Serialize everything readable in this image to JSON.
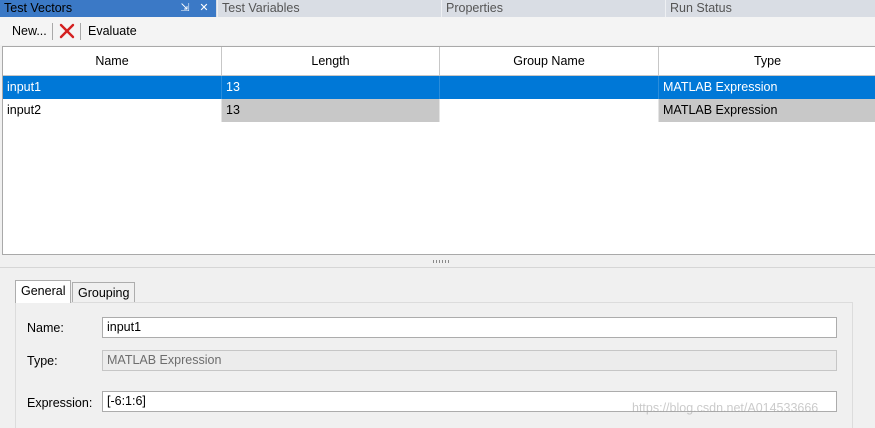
{
  "tabs": [
    {
      "label": "Test Vectors",
      "active": true
    },
    {
      "label": "Test Variables",
      "active": false
    },
    {
      "label": "Properties",
      "active": false
    },
    {
      "label": "Run Status",
      "active": false
    }
  ],
  "tab_controls": {
    "pin": "⇲",
    "close": "✕"
  },
  "toolbar": {
    "new_label": "New...",
    "delete_icon": "red-x-icon",
    "evaluate_label": "Evaluate"
  },
  "grid": {
    "columns": [
      "Name",
      "Length",
      "Group Name",
      "Type"
    ],
    "rows": [
      {
        "name": "input1",
        "length": "13",
        "group": "",
        "type": "MATLAB Expression",
        "selected": true
      },
      {
        "name": "input2",
        "length": "13",
        "group": "",
        "type": "MATLAB Expression",
        "selected": false
      }
    ]
  },
  "details": {
    "tabs": [
      "General",
      "Grouping"
    ],
    "name_label": "Name:",
    "name_value": "input1",
    "type_label": "Type:",
    "type_value": "MATLAB Expression",
    "expression_label": "Expression:",
    "expression_value": "[-6:1:6]"
  },
  "watermark": "https://blog.csdn.net/A014533666",
  "colors": {
    "selection": "#0078d7",
    "active_tab": "#3b79c6",
    "delete_icon": "#d42020"
  }
}
